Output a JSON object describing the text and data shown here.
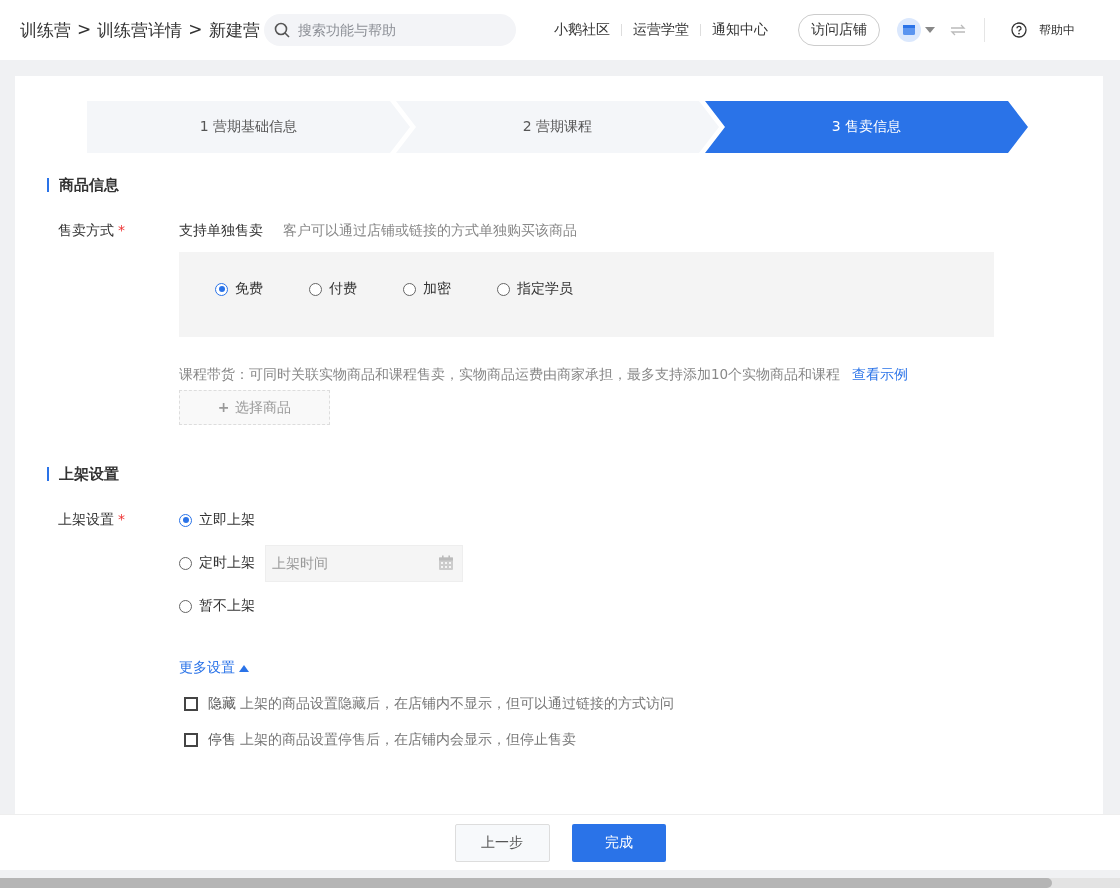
{
  "header": {
    "breadcrumb": [
      "训练营",
      "训练营详情",
      "新建营"
    ],
    "separator": ">",
    "search": {
      "placeholder": "搜索功能与帮助"
    },
    "links": [
      "小鹅社区",
      "运营学堂",
      "通知中心"
    ],
    "visit_button": "访问店铺",
    "help": "帮助中"
  },
  "steps": [
    {
      "label": "1 营期基础信息",
      "selected": false
    },
    {
      "label": "2 营期课程",
      "selected": false
    },
    {
      "label": "3 售卖信息",
      "selected": true
    }
  ],
  "product_section": {
    "title": "商品信息",
    "field_label": "售卖方式",
    "required": "*",
    "mode_title": "支持单独售卖",
    "mode_desc": "客户可以通过店铺或链接的方式单独购买该商品",
    "options": [
      {
        "label": "免费",
        "selected": true
      },
      {
        "label": "付费",
        "selected": false
      },
      {
        "label": "加密",
        "selected": false
      },
      {
        "label": "指定学员",
        "selected": false
      }
    ],
    "bundle_note": "课程带货：可同时关联实物商品和课程售卖，实物商品运费由商家承担，最多支持添加10个实物商品和课程",
    "bundle_link": "查看示例",
    "select_button": {
      "icon": "+",
      "label": "选择商品",
      "disabled": true
    }
  },
  "listing_section": {
    "title": "上架设置",
    "field_label": "上架设置",
    "required": "*",
    "options": [
      {
        "label": "立即上架",
        "selected": true
      },
      {
        "label": "定时上架",
        "selected": false,
        "placeholder": "上架时间"
      },
      {
        "label": "暂不上架",
        "selected": false
      }
    ],
    "more_link": "更多设置",
    "expanded": true,
    "checks": [
      {
        "label": "隐藏",
        "desc": "上架的商品设置隐藏后，在店铺内不显示，但可以通过链接的方式访问",
        "checked": false
      },
      {
        "label": "停售",
        "desc": "上架的商品设置停售后，在店铺内会显示，但停止售卖",
        "checked": false
      }
    ]
  },
  "footer": {
    "back": "上一步",
    "finish": "完成"
  }
}
